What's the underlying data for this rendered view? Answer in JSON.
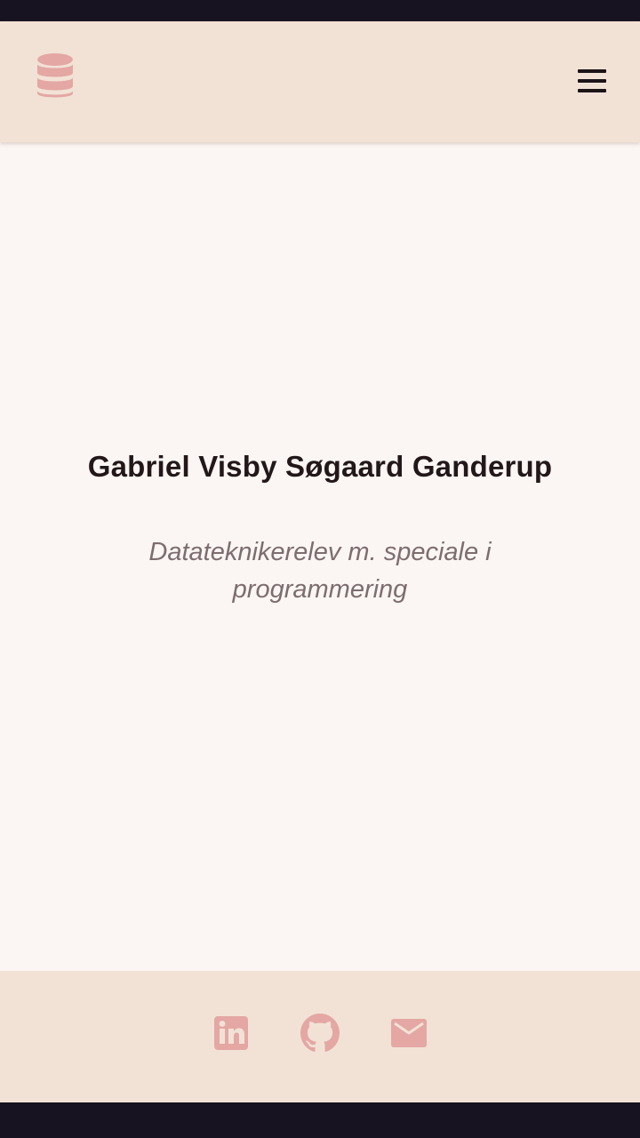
{
  "header": {
    "logo_icon": "database-icon",
    "menu_icon": "hamburger-menu-icon"
  },
  "hero": {
    "name": "Gabriel Visby Søgaard Ganderup",
    "subtitle": "Datateknikerelev m. speciale i programmering"
  },
  "footer": {
    "links": [
      {
        "icon": "linkedin-icon"
      },
      {
        "icon": "github-icon"
      },
      {
        "icon": "mail-icon"
      }
    ]
  },
  "colors": {
    "header_background": "#f2e2d6",
    "page_background": "#fbf6f4",
    "accent": "#e4a7a3",
    "title_text": "#22181a",
    "subtitle_text": "#7d6d70",
    "system_bar": "#171320"
  }
}
